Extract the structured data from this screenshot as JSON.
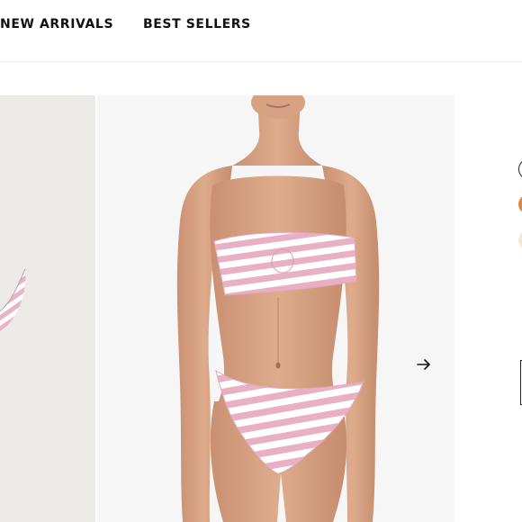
{
  "nav": {
    "items": [
      {
        "label": "NEW ARRIVALS"
      },
      {
        "label": "BEST SELLERS"
      }
    ]
  },
  "gallery": {
    "next_icon": "arrow-right-icon",
    "main_image_alt": "model wearing pink and white striped bandeau bikini"
  },
  "colors": {
    "stripe_pink": "#eab4c8",
    "stripe_white": "#ffffff",
    "skin": "#d9a585",
    "left_bg": "#ecebe7"
  }
}
